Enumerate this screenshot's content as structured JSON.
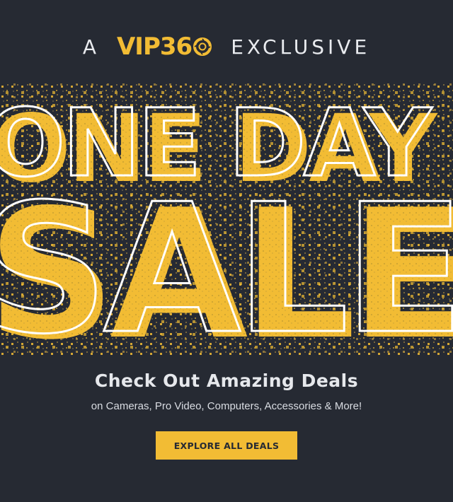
{
  "header": {
    "prefix": "A",
    "logo_text": "VIP36",
    "suffix": "EXCLUSIVE"
  },
  "hero": {
    "line1": "ONE DAY",
    "line2": "SALE"
  },
  "promo": {
    "headline": "Check Out Amazing Deals",
    "subtext": "on Cameras, Pro Video, Computers, Accessories & More!"
  },
  "cta": {
    "label": "EXPLORE ALL DEALS"
  },
  "colors": {
    "background": "#262a33",
    "accent": "#f2bc34",
    "text": "#e6e8ec"
  },
  "icons": {
    "logo_zero": "aperture-icon"
  }
}
